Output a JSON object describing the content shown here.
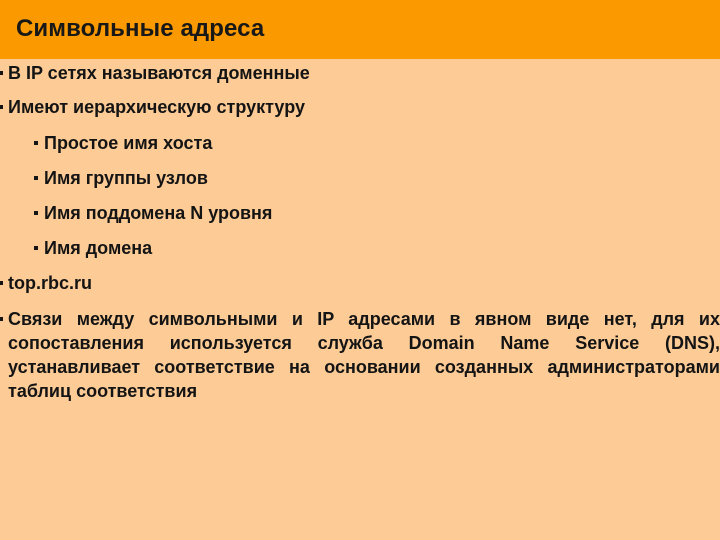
{
  "slide": {
    "title": "Символьные адреса",
    "colors": {
      "title_band": "#FB9900",
      "body_background": "#FCCB96",
      "text": "#141414"
    },
    "bullets": [
      {
        "level": 1,
        "text": "В IP сетях называются доменные"
      },
      {
        "level": 1,
        "text": "Имеют иерархическую структуру"
      },
      {
        "level": 2,
        "text": "Простое имя хоста"
      },
      {
        "level": 2,
        "text": "Имя группы узлов"
      },
      {
        "level": 2,
        "text": "Имя поддомена N уровня"
      },
      {
        "level": 2,
        "text": "Имя домена"
      },
      {
        "level": 1,
        "text": "top.rbc.ru"
      }
    ],
    "paragraph": "Связи между символьными и IP адресами в явном виде нет, для их сопоставления используется служба Domain Name Service (DNS), устанавливает соответствие на основании созданных администраторами таблиц соответствия"
  }
}
